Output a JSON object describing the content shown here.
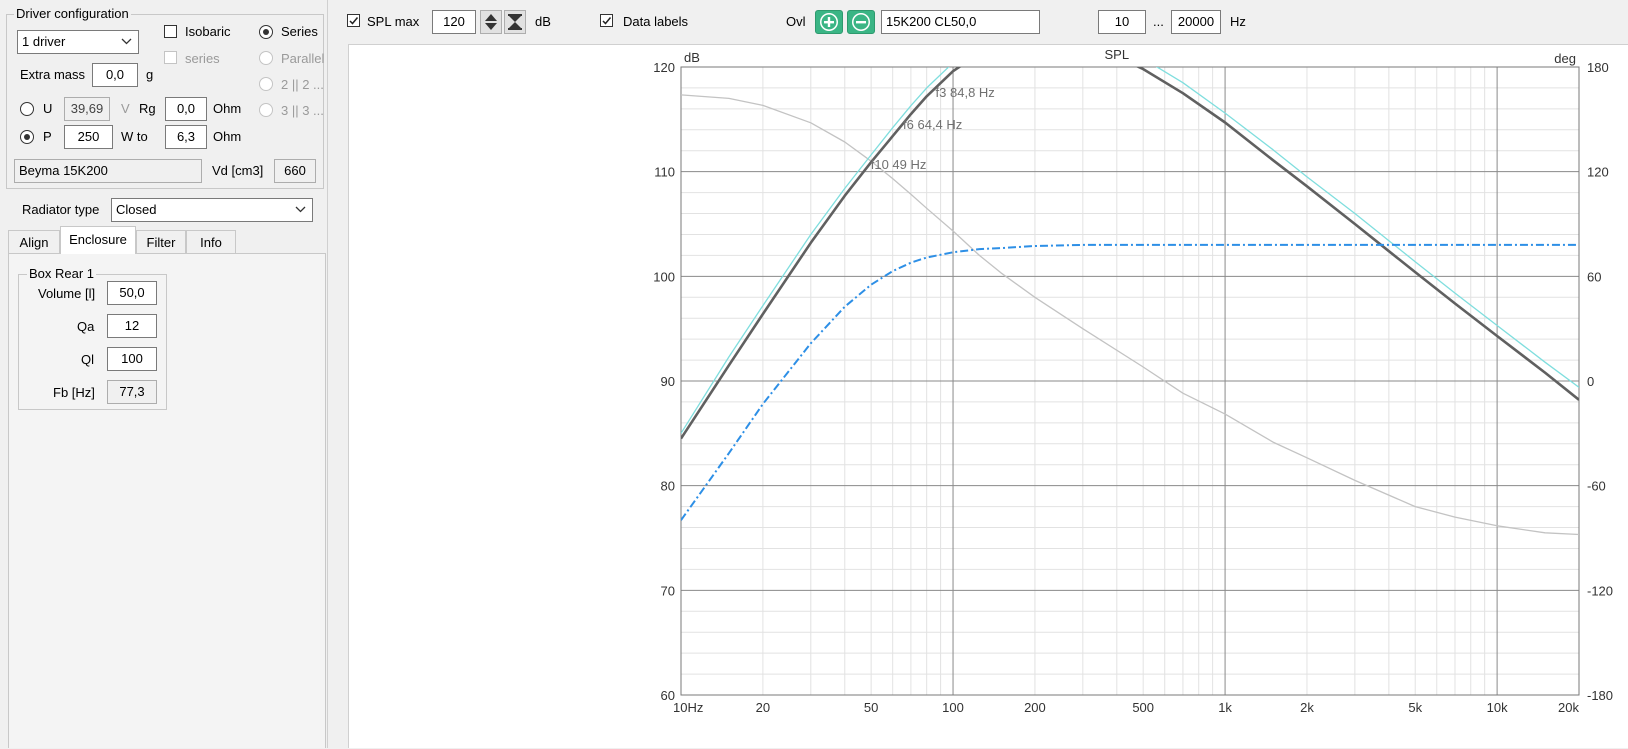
{
  "driver_config": {
    "title": "Driver configuration",
    "driver_count": "1 driver",
    "isobaric_label": "Isobaric",
    "isobaric_checked": false,
    "series_check_label": "series",
    "series_radio_label": "Series",
    "parallel_label": "Parallel",
    "opt_2_label": "2 || 2 ...",
    "opt_3_label": "3 || 3 ...",
    "extra_mass_label": "Extra mass",
    "extra_mass_value": "0,0",
    "extra_mass_unit": "g",
    "u_label": "U",
    "u_value": "39,69",
    "u_unit": "V",
    "rg_label": "Rg",
    "rg_value": "0,0",
    "rg_unit": "Ohm",
    "p_label": "P",
    "p_value": "250",
    "p_unit": "W to",
    "p_ohm_value": "6,3",
    "p_ohm_unit": "Ohm",
    "driver_name": "Beyma 15K200",
    "vd_label": "Vd [cm3]",
    "vd_value": "660"
  },
  "radiator": {
    "label": "Radiator type",
    "value": "Closed"
  },
  "tabs": [
    {
      "label": "Align"
    },
    {
      "label": "Enclosure"
    },
    {
      "label": "Filter"
    },
    {
      "label": "Info"
    }
  ],
  "box": {
    "title": "Box Rear 1",
    "volume_label": "Volume [l]",
    "volume_value": "50,0",
    "qa_label": "Qa",
    "qa_value": "12",
    "ql_label": "Ql",
    "ql_value": "100",
    "fb_label": "Fb [Hz]",
    "fb_value": "77,3"
  },
  "toolbar": {
    "spl_max_label": "SPL max",
    "spl_max_checked": true,
    "spl_max_value": "120",
    "db_label": "dB",
    "data_labels_label": "Data labels",
    "data_labels_checked": true,
    "ovl_label": "Ovl",
    "overlay_name": "15K200 CL50,0",
    "freq_from": "10",
    "freq_sep": "...",
    "freq_to": "20000",
    "hz_label": "Hz"
  },
  "chart_data": {
    "type": "line",
    "title": "SPL",
    "ylabel_left": "dB",
    "ylabel_right": "deg",
    "x_scale": "log",
    "xlim": [
      10,
      20000
    ],
    "ylim_left": [
      60,
      120
    ],
    "ylim_right": [
      -180,
      180
    ],
    "grid": true,
    "x_tick_labels": [
      "10Hz",
      "20",
      "50",
      "100",
      "200",
      "500",
      "1k",
      "2k",
      "5k",
      "10k",
      "20k"
    ],
    "x_tick_values": [
      10,
      20,
      50,
      100,
      200,
      500,
      1000,
      2000,
      5000,
      10000,
      20000
    ],
    "y_left_ticks": [
      "60",
      "70",
      "80",
      "90",
      "100",
      "110",
      "120"
    ],
    "y_left_tick_values": [
      60,
      70,
      80,
      90,
      100,
      110,
      120
    ],
    "y_right_ticks": [
      "-180",
      "-120",
      "-60",
      "0",
      "60",
      "120",
      "180"
    ],
    "y_right_tick_values": [
      -180,
      -120,
      -60,
      0,
      60,
      120,
      180
    ],
    "series": [
      {
        "axis": "left",
        "color": "#606060",
        "x": [
          10,
          15,
          20,
          30,
          40,
          50,
          60,
          70,
          80,
          100,
          125,
          150,
          200,
          250,
          300,
          400,
          500,
          700,
          1000,
          1500,
          2000,
          3000,
          4000,
          5000,
          7000,
          10000,
          15000,
          20000
        ],
        "y": [
          84.5,
          91.5,
          96.4,
          103.2,
          107.7,
          110.9,
          113.4,
          115.5,
          117.2,
          119.6,
          121.3,
          122.3,
          123.1,
          123.1,
          122.5,
          121.0,
          119.8,
          117.5,
          114.7,
          111.1,
          108.6,
          105.0,
          102.4,
          100.4,
          97.4,
          94.3,
          90.8,
          88.2
        ]
      },
      {
        "axis": "left",
        "color": "#7fdede",
        "x": [
          10,
          15,
          20,
          30,
          40,
          50,
          60,
          70,
          80,
          100,
          125,
          150,
          200,
          250,
          300,
          400,
          500,
          700,
          1000,
          1500,
          2000,
          3000,
          4000,
          5000,
          7000,
          10000,
          15000,
          20000
        ],
        "y": [
          85.0,
          92.3,
          97.2,
          104.0,
          108.4,
          111.6,
          114.2,
          116.3,
          118.0,
          120.4,
          122.0,
          123.0,
          123.8,
          123.9,
          123.4,
          122.0,
          120.8,
          118.5,
          115.6,
          112.1,
          109.5,
          106.0,
          103.4,
          101.4,
          98.4,
          95.3,
          91.8,
          89.4
        ]
      },
      {
        "axis": "left",
        "color": "#2d8fe6",
        "dash": "8,3,2,3",
        "x": [
          10,
          15,
          20,
          30,
          40,
          50,
          60,
          70,
          80,
          100,
          125,
          150,
          200,
          300,
          500,
          1000,
          2000,
          5000,
          10000,
          20000
        ],
        "y": [
          76.7,
          83.1,
          87.8,
          93.6,
          97.1,
          99.2,
          100.5,
          101.3,
          101.8,
          102.3,
          102.6,
          102.7,
          102.9,
          103.0,
          103.0,
          103.0,
          103.0,
          103.0,
          103.0,
          103.0
        ]
      },
      {
        "axis": "right",
        "color": "#c3c3c3",
        "x": [
          10,
          15,
          20,
          30,
          40,
          50,
          60,
          70,
          80,
          100,
          125,
          150,
          200,
          300,
          500,
          700,
          1000,
          1500,
          2000,
          3000,
          5000,
          7000,
          10000,
          15000,
          20000
        ],
        "y": [
          164,
          162,
          158,
          148,
          137,
          126,
          116,
          107,
          99,
          86,
          72,
          62,
          48,
          30,
          8,
          -7,
          -19,
          -35,
          -44,
          -57,
          -72,
          -78,
          -83,
          -87,
          -88
        ]
      }
    ],
    "annotations": [
      {
        "text": "f3 84,8 Hz",
        "x": 84.8
      },
      {
        "text": "f6 64,4 Hz",
        "x": 64.4
      },
      {
        "text": "f10 49 Hz",
        "x": 49
      }
    ]
  },
  "colors": {
    "spl_main": "#606060",
    "spl_overlay": "#7fdede",
    "group_delay": "#2d8fe6",
    "phase": "#c3c3c3",
    "accent_green": "#3ab585"
  }
}
